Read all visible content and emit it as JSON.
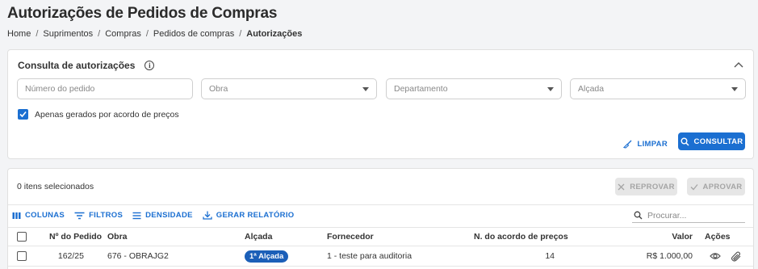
{
  "page": {
    "title": "Autorizações de Pedidos de Compras",
    "breadcrumb": [
      "Home",
      "Suprimentos",
      "Compras",
      "Pedidos de compras",
      "Autorizações"
    ]
  },
  "filter": {
    "title": "Consulta de autorizações",
    "order_number_placeholder": "Número do pedido",
    "obra_placeholder": "Obra",
    "department_placeholder": "Departamento",
    "alcada_placeholder": "Alçada",
    "checkbox_label": "Apenas gerados por acordo de preços",
    "checkbox_checked": true,
    "clear_label": "LIMPAR",
    "consult_label": "CONSULTAR"
  },
  "list": {
    "selected_count": "0 itens selecionados",
    "reject_label": "REPROVAR",
    "approve_label": "APROVAR",
    "toolbar": {
      "columns": "COLUNAS",
      "filters": "FILTROS",
      "density": "DENSIDADE",
      "report": "GERAR RELATÓRIO"
    },
    "search_placeholder": "Procurar...",
    "columns": {
      "order": "Nº do Pedido",
      "obra": "Obra",
      "alcada": "Alçada",
      "supplier": "Fornecedor",
      "agreement": "N. do acordo de preços",
      "value": "Valor",
      "actions": "Ações"
    },
    "rows": [
      {
        "order": "162/25",
        "obra": "676 - OBRAJG2",
        "alcada": "1ª Alçada",
        "supplier": "1 - teste para auditoria",
        "agreement": "14",
        "value": "R$ 1.000,00"
      }
    ]
  },
  "colors": {
    "primary": "#1b6fd1",
    "badge": "#1b5fb8",
    "disabled_bg": "#e6e6e6",
    "disabled_text": "#a5a5a5"
  }
}
